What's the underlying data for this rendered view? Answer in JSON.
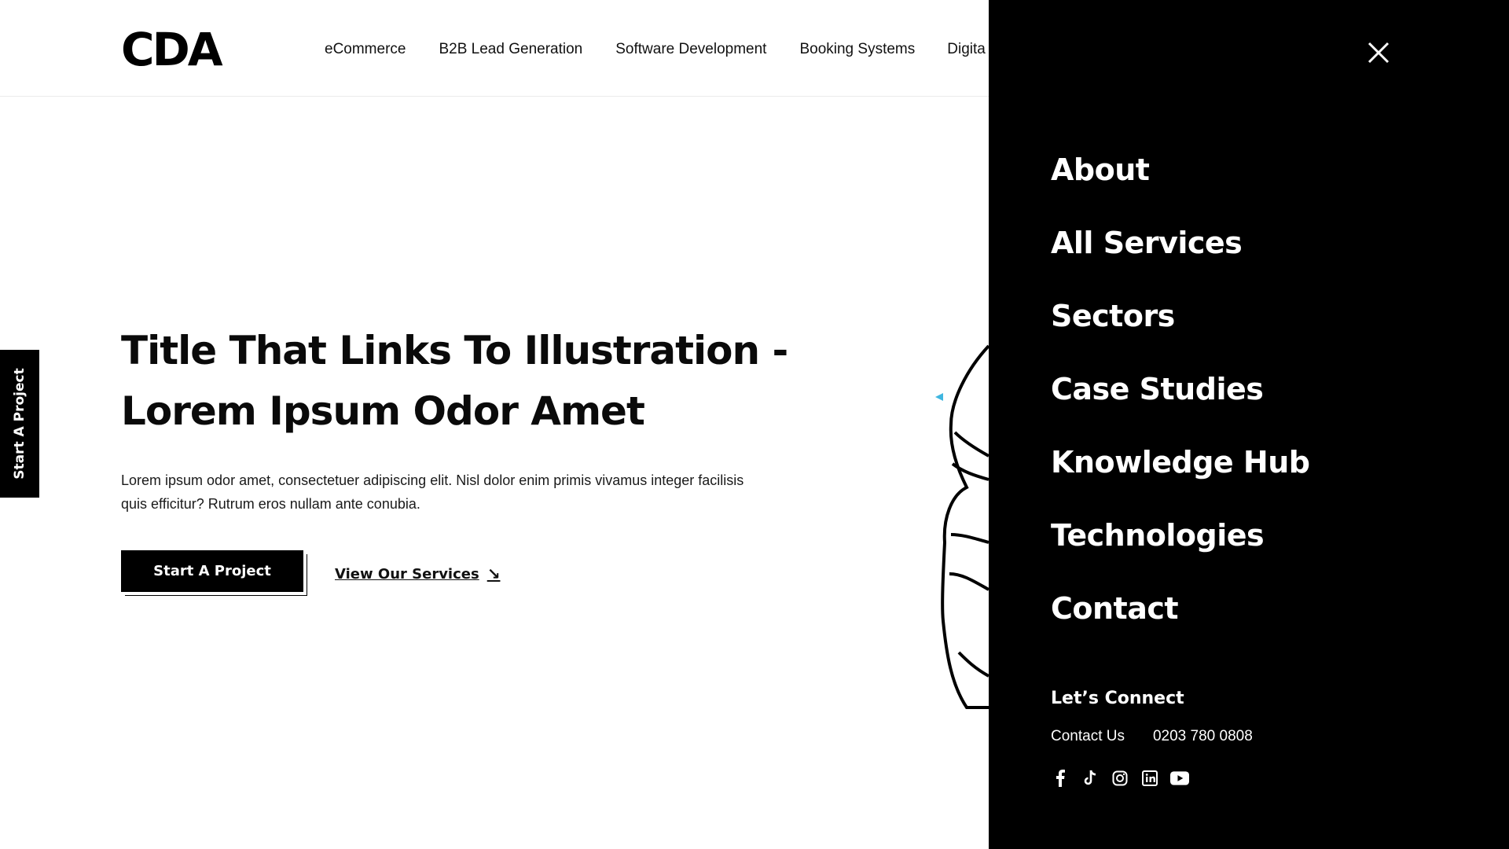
{
  "header": {
    "logo": "CDA",
    "nav": [
      "eCommerce",
      "B2B Lead Generation",
      "Software Development",
      "Booking Systems",
      "Digita"
    ]
  },
  "side_tab": {
    "label": "Start A Project"
  },
  "hero": {
    "title_line1": "Title That Links To Illustration -",
    "title_line2": "Lorem Ipsum Odor Amet",
    "body": "Lorem ipsum odor amet, consectetuer adipiscing elit. Nisl dolor enim primis vivamus integer facilisis quis efficitur? Rutrum eros nullam ante conubia.",
    "primary_button": "Start A Project",
    "secondary_link": "View Our Services",
    "secondary_arrow": "↘"
  },
  "menu": {
    "close_icon": "close-icon",
    "items": [
      "About",
      "All Services",
      "Sectors",
      "Case Studies",
      "Knowledge Hub",
      "Technologies",
      "Contact"
    ],
    "connect_heading": "Let’s Connect",
    "contact_label": "Contact Us",
    "phone": "0203 780 0808",
    "social_icons": [
      "facebook-icon",
      "tiktok-icon",
      "instagram-icon",
      "linkedin-icon",
      "youtube-icon"
    ]
  },
  "colors": {
    "accent": "#3fb6e0",
    "panel_bg": "#000000",
    "text": "#0a0a0a"
  }
}
